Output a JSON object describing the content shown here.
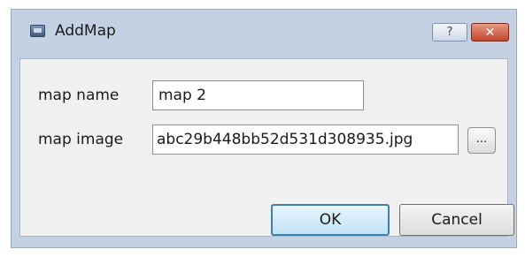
{
  "window": {
    "title": "AddMap",
    "help_label": "?",
    "close_label": "✕",
    "icon": "map-app-icon"
  },
  "form": {
    "map_name_label": "map name",
    "map_name_value": "map 2",
    "map_image_label": "map image",
    "map_image_value": "abc29b448bb52d531d308935.jpg",
    "browse_label": "..."
  },
  "buttons": {
    "ok_label": "OK",
    "cancel_label": "Cancel"
  },
  "colors": {
    "frame": "#c3d1e3",
    "close_button": "#c5452c",
    "ok_border": "#3c7fb1"
  }
}
